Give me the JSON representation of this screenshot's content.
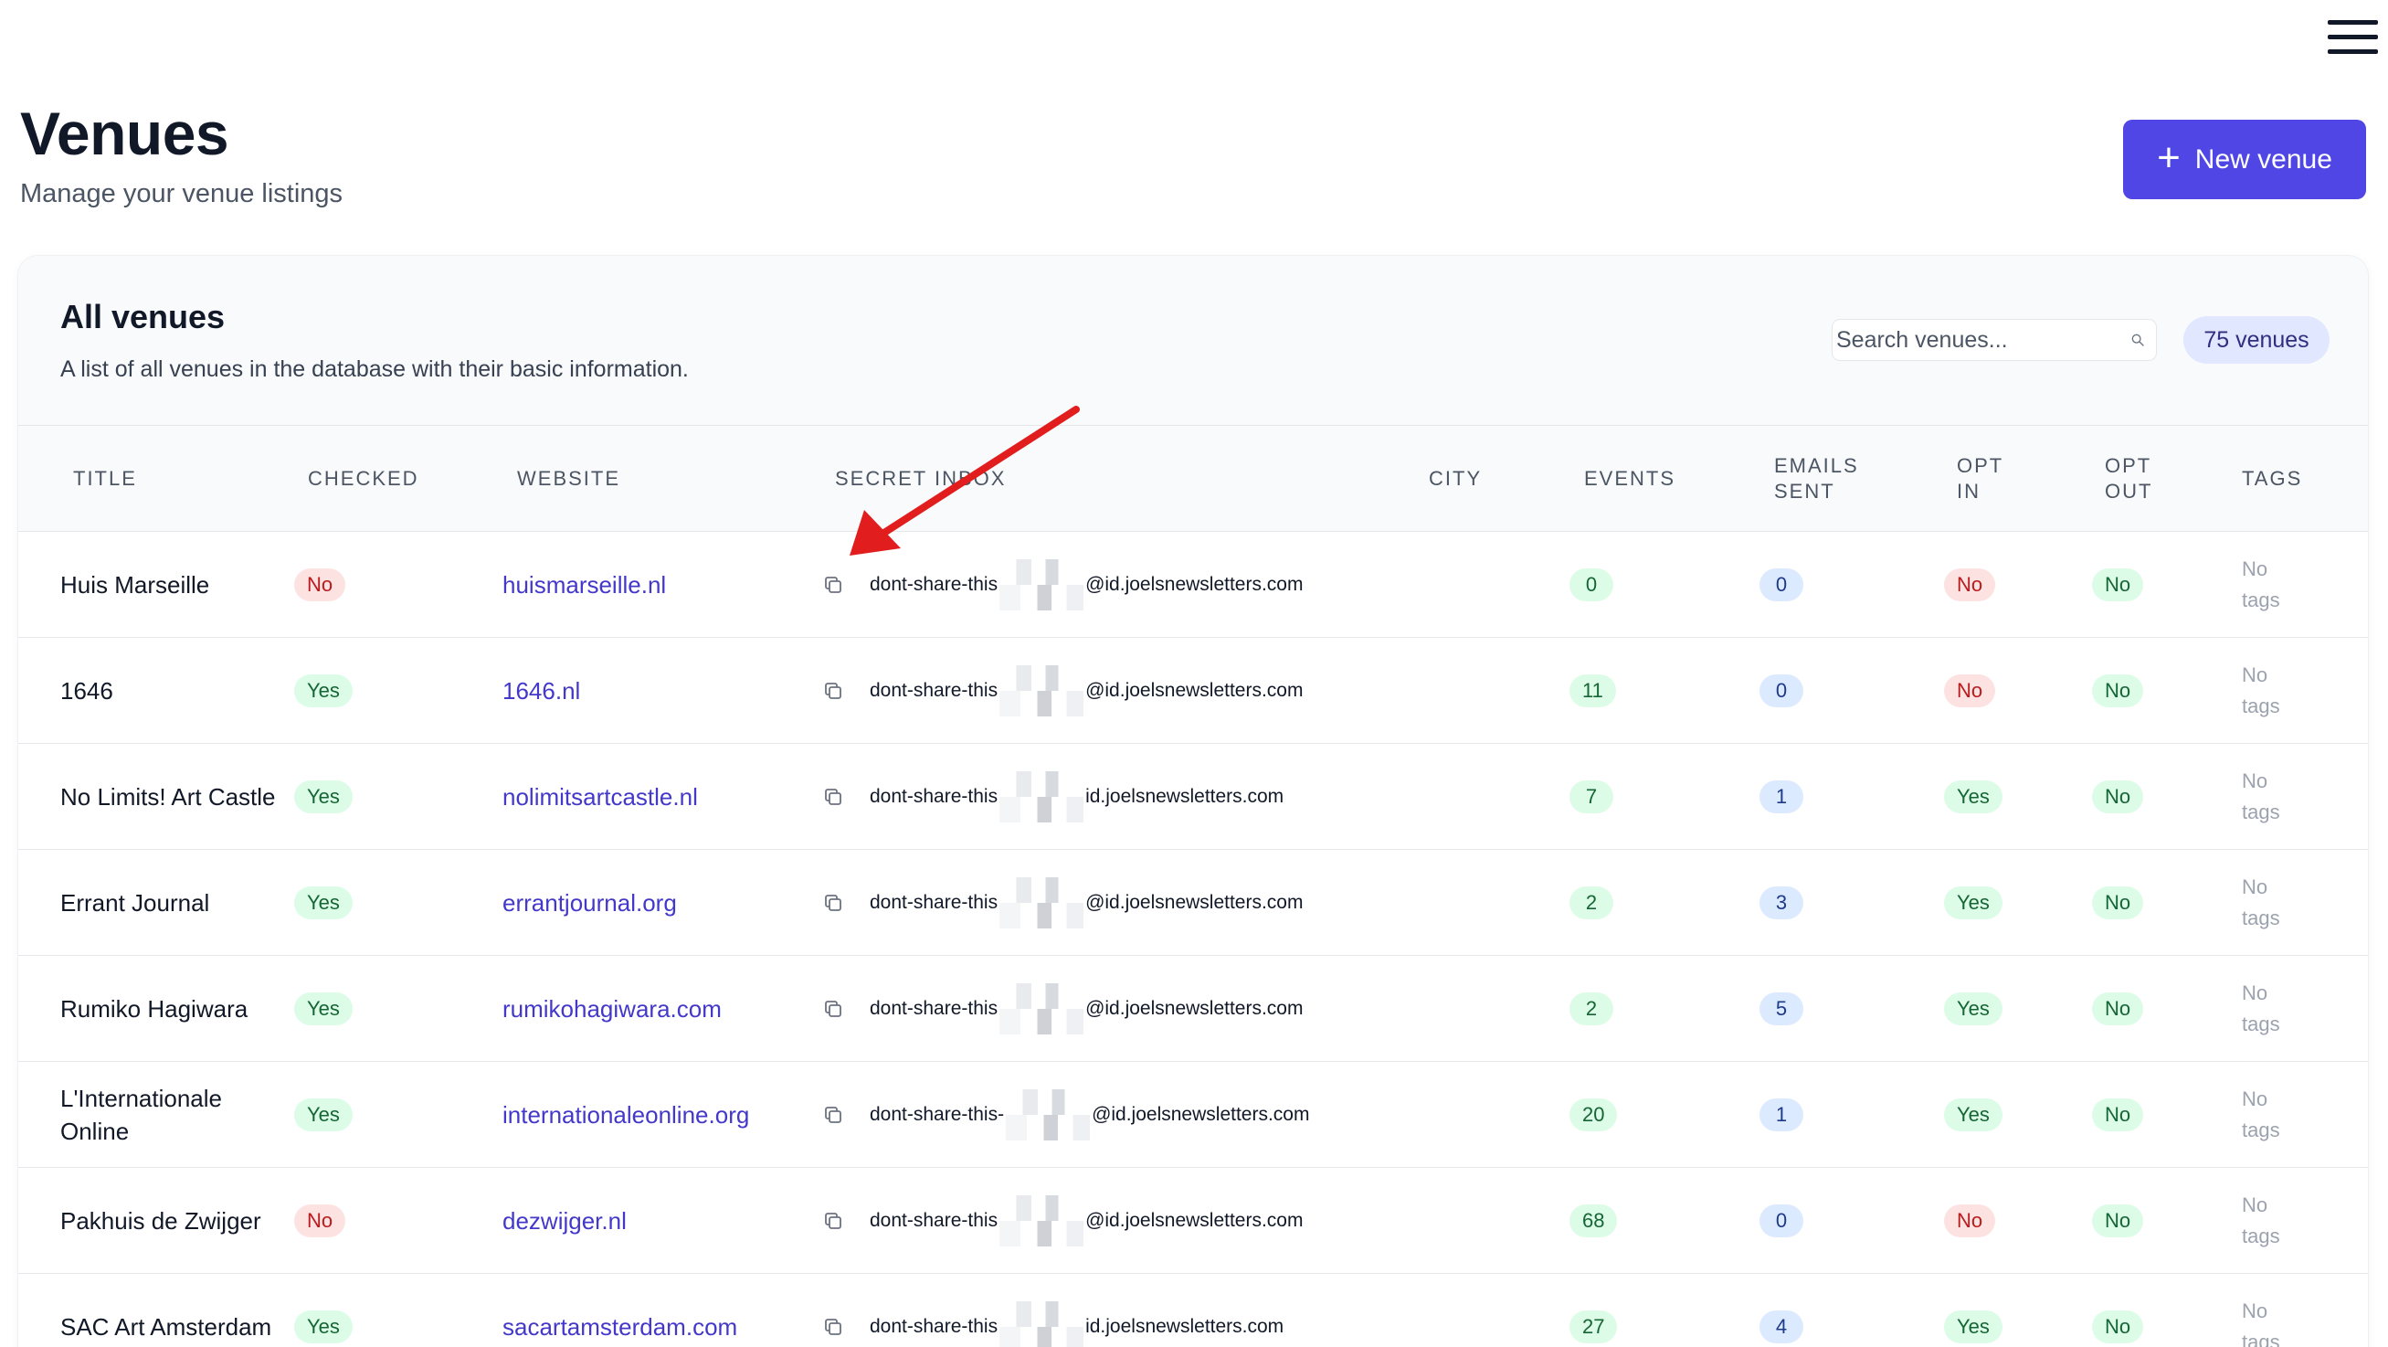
{
  "header": {
    "title": "Venues",
    "subtitle": "Manage your venue listings",
    "new_button_label": "New venue",
    "new_button_icon": "plus-icon",
    "menu_icon": "hamburger-menu-icon"
  },
  "card": {
    "title": "All venues",
    "description": "A list of all venues in the database with their basic information.",
    "search_placeholder": "Search venues...",
    "count_label": "75 venues"
  },
  "columns": {
    "title": "TITLE",
    "checked": "CHECKED",
    "website": "WEBSITE",
    "secret_inbox": "SECRET INBOX",
    "city": "CITY",
    "events": "EVENTS",
    "emails_sent_1": "EMAILS",
    "emails_sent_2": "SENT",
    "opt_in_1": "OPT",
    "opt_in_2": "IN",
    "opt_out_1": "OPT",
    "opt_out_2": "OUT",
    "tags": "TAGS"
  },
  "rows": [
    {
      "title": "Huis Marseille",
      "checked": "No",
      "website": "huismarseille.nl",
      "inbox_prefix": "dont-share-this",
      "inbox_suffix": "@id.joelsnewsletters.com",
      "city": "",
      "events": "0",
      "emails_sent": "0",
      "opt_in": "No",
      "opt_out": "No",
      "tags_1": "No",
      "tags_2": "tags"
    },
    {
      "title": "1646",
      "checked": "Yes",
      "website": "1646.nl",
      "inbox_prefix": "dont-share-this",
      "inbox_suffix": "@id.joelsnewsletters.com",
      "city": "",
      "events": "11",
      "emails_sent": "0",
      "opt_in": "No",
      "opt_out": "No",
      "tags_1": "No",
      "tags_2": "tags"
    },
    {
      "title": "No Limits! Art Castle",
      "checked": "Yes",
      "website": "nolimitsartcastle.nl",
      "inbox_prefix": "dont-share-this",
      "inbox_suffix": "id.joelsnewsletters.com",
      "city": "",
      "events": "7",
      "emails_sent": "1",
      "opt_in": "Yes",
      "opt_out": "No",
      "tags_1": "No",
      "tags_2": "tags"
    },
    {
      "title": "Errant Journal",
      "checked": "Yes",
      "website": "errantjournal.org",
      "inbox_prefix": "dont-share-this",
      "inbox_suffix": "@id.joelsnewsletters.com",
      "city": "",
      "events": "2",
      "emails_sent": "3",
      "opt_in": "Yes",
      "opt_out": "No",
      "tags_1": "No",
      "tags_2": "tags"
    },
    {
      "title": "Rumiko Hagiwara",
      "checked": "Yes",
      "website": "rumikohagiwara.com",
      "inbox_prefix": "dont-share-this",
      "inbox_suffix": "@id.joelsnewsletters.com",
      "city": "",
      "events": "2",
      "emails_sent": "5",
      "opt_in": "Yes",
      "opt_out": "No",
      "tags_1": "No",
      "tags_2": "tags"
    },
    {
      "title": "L'Internationale Online",
      "checked": "Yes",
      "website": "internationaleonline.org",
      "inbox_prefix": "dont-share-this-",
      "inbox_suffix": "@id.joelsnewsletters.com",
      "city": "",
      "events": "20",
      "emails_sent": "1",
      "opt_in": "Yes",
      "opt_out": "No",
      "tags_1": "No",
      "tags_2": "tags"
    },
    {
      "title": "Pakhuis de Zwijger",
      "checked": "No",
      "website": "dezwijger.nl",
      "inbox_prefix": "dont-share-this",
      "inbox_suffix": "@id.joelsnewsletters.com",
      "city": "",
      "events": "68",
      "emails_sent": "0",
      "opt_in": "No",
      "opt_out": "No",
      "tags_1": "No",
      "tags_2": "tags"
    },
    {
      "title": "SAC Art Amsterdam",
      "checked": "Yes",
      "website": "sacartamsterdam.com",
      "inbox_prefix": "dont-share-this",
      "inbox_suffix": "id.joelsnewsletters.com",
      "city": "",
      "events": "27",
      "emails_sent": "4",
      "opt_in": "Yes",
      "opt_out": "No",
      "tags_1": "No",
      "tags_2": "tags"
    }
  ],
  "colors": {
    "accent": "#4f46e5",
    "annotation_arrow": "#e11d1d"
  }
}
